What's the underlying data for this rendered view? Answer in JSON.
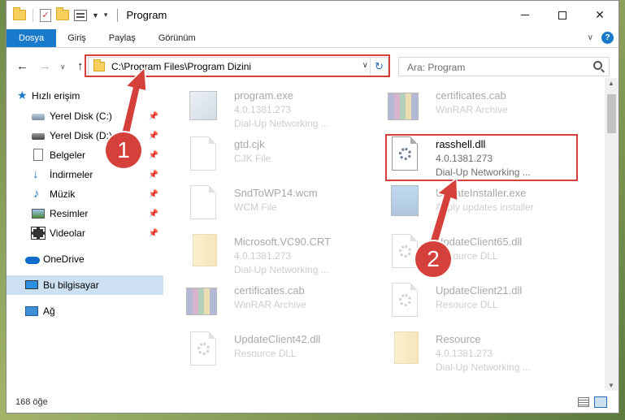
{
  "window": {
    "title": "Program",
    "controls": [
      "minimize",
      "maximize",
      "close"
    ]
  },
  "ribbon": {
    "tabs": [
      "Dosya",
      "Giriş",
      "Paylaş",
      "Görünüm"
    ]
  },
  "address": {
    "path": "C:\\Program Files\\Program Dizini",
    "search_placeholder": "Ara: Program"
  },
  "nav_pane": {
    "quick_access": "Hızlı erişim",
    "items": [
      {
        "label": "Yerel Disk (C:)",
        "icon": "local-disk-icon",
        "pinned": true
      },
      {
        "label": "Yerel Disk (D:)",
        "icon": "local-disk-icon",
        "pinned": true
      },
      {
        "label": "Belgeler",
        "icon": "documents-icon",
        "pinned": true
      },
      {
        "label": "İndirmeler",
        "icon": "downloads-icon",
        "pinned": true
      },
      {
        "label": "Müzik",
        "icon": "music-icon",
        "pinned": true
      },
      {
        "label": "Resimler",
        "icon": "pictures-icon",
        "pinned": true
      },
      {
        "label": "Videolar",
        "icon": "videos-icon",
        "pinned": true
      }
    ],
    "onedrive": "OneDrive",
    "this_pc": "Bu bilgisayar",
    "network": "Ağ"
  },
  "files": [
    {
      "name": "program.exe",
      "line1": "4.0.1381.273",
      "line2": "Dial-Up Networking ...",
      "icon": "exe-icon"
    },
    {
      "name": "certificates.cab",
      "line1": "WinRAR Archive",
      "line2": "",
      "icon": "winrar-icon"
    },
    {
      "name": "gtd.cjk",
      "line1": "CJK File",
      "line2": "",
      "icon": "blank-file-icon"
    },
    {
      "name": "rasshell.dll",
      "line1": "4.0.1381.273",
      "line2": "Dial-Up Networking ...",
      "icon": "dll-gear-icon"
    },
    {
      "name": "SndToWP14.wcm",
      "line1": "WCM File",
      "line2": "",
      "icon": "blank-file-icon"
    },
    {
      "name": "UpdateInstaller.exe",
      "line1": "Apply updates installer",
      "line2": "",
      "icon": "installer-icon"
    },
    {
      "name": "Microsoft.VC90.CRT",
      "line1": "4.0.1381.273",
      "line2": "Dial-Up Networking ...",
      "icon": "folder-icon"
    },
    {
      "name": "UpdateClient65.dll",
      "line1": "Resource DLL",
      "line2": "",
      "icon": "dll-gear-icon"
    },
    {
      "name": "certificates.cab",
      "line1": "WinRAR Archive",
      "line2": "",
      "icon": "winrar-icon"
    },
    {
      "name": "UpdateClient21.dll",
      "line1": "Resource DLL",
      "line2": "",
      "icon": "dll-gear-icon"
    },
    {
      "name": "UpdateClient42.dll",
      "line1": "Resource DLL",
      "line2": "",
      "icon": "dll-gear-icon"
    },
    {
      "name": "Resource",
      "line1": "4.0.1381.273",
      "line2": "Dial-Up Networking ...",
      "icon": "folder-icon"
    }
  ],
  "callouts": [
    "1",
    "2"
  ],
  "status": {
    "count": "168 öğe"
  },
  "colors": {
    "accent": "#1979ca",
    "highlight_red": "#d6403b"
  }
}
